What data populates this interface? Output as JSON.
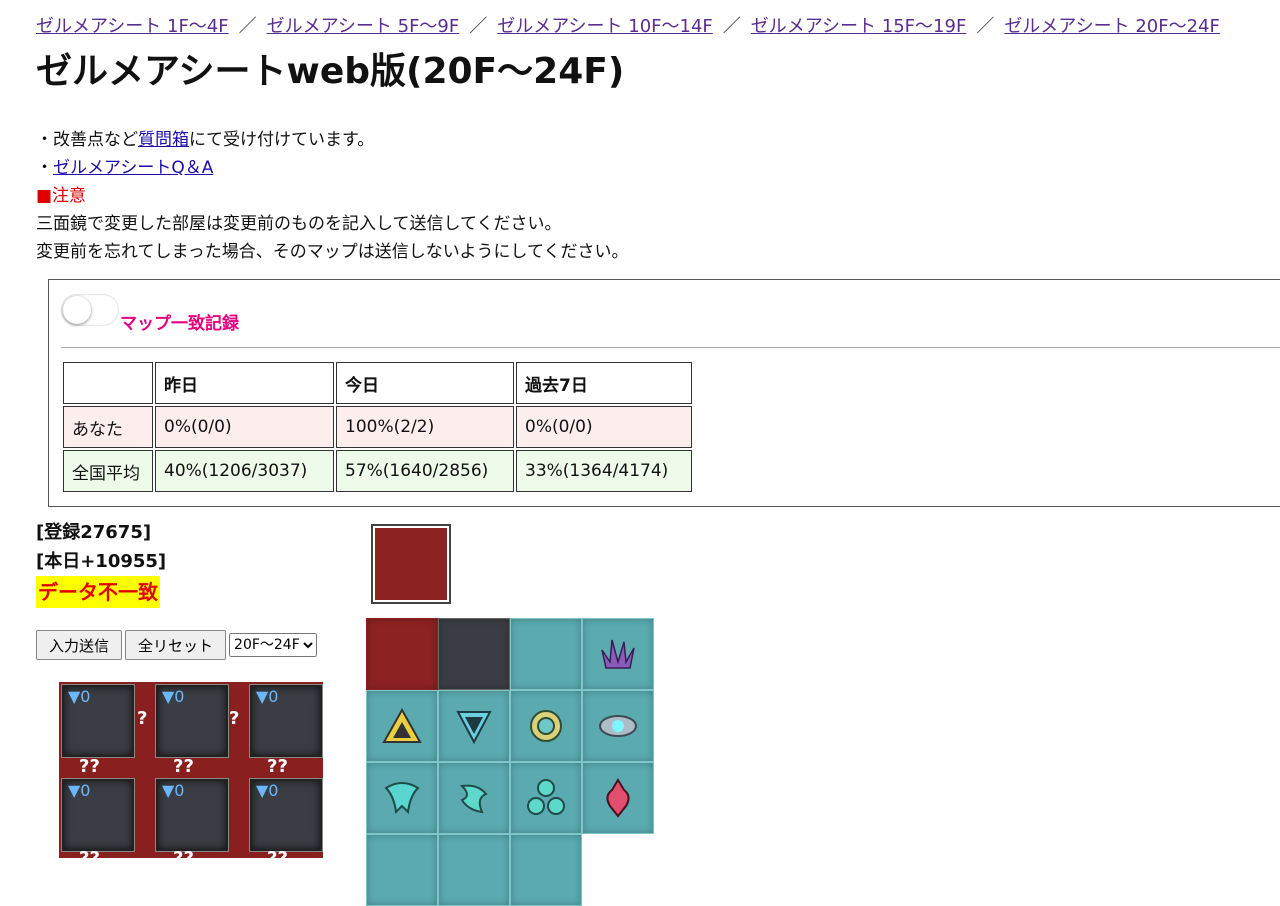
{
  "nav": {
    "links": [
      "ゼルメアシート 1F～4F",
      "ゼルメアシート 5F～9F",
      "ゼルメアシート 10F～14F",
      "ゼルメアシート 15F～19F",
      "ゼルメアシート 20F～24F"
    ],
    "separator": "／"
  },
  "title": "ゼルメアシートweb版(20F～24F)",
  "notes": {
    "line1_pre": "・改善点など",
    "line1_link": "質問箱",
    "line1_post": "にて受け付けています。",
    "line2_pre": "・",
    "line2_link": "ゼルメアシートQ＆A",
    "warning": "■注意",
    "line3": "三面鏡で変更した部屋は変更前のものを記入して送信してください。",
    "line4": "変更前を忘れてしまった場合、そのマップは送信しないようにしてください。"
  },
  "stats": {
    "toggle_label": "マップ一致記録",
    "headers": [
      "",
      "昨日",
      "今日",
      "過去7日"
    ],
    "you": [
      "あなた",
      "0%(0/0)",
      "100%(2/2)",
      "0%(0/0)"
    ],
    "national": [
      "全国平均",
      "40%(1206/3037)",
      "57%(1640/2856)",
      "33%(1364/4174)"
    ]
  },
  "summary": {
    "registered": "[登録27675]",
    "today": "[本日+10955]",
    "mismatch": "データ不一致"
  },
  "controls": {
    "submit": "入力送信",
    "reset": "全リセット",
    "floor_selected": "20F～24F"
  },
  "grid": {
    "count_label": "▼0",
    "question": "?",
    "qq": "??"
  },
  "colors": {
    "nav_link": "#5a2d91",
    "link": "#1a0dab",
    "warning": "#e00000",
    "toggle_label": "#e4007f",
    "mismatch_bg": "#ffff00",
    "you_bg": "#fdeeee",
    "national_bg": "#eefaea",
    "tile_red": "#8d2222",
    "tile_teal": "#5aaab0",
    "tile_dark": "#3a3d43"
  }
}
